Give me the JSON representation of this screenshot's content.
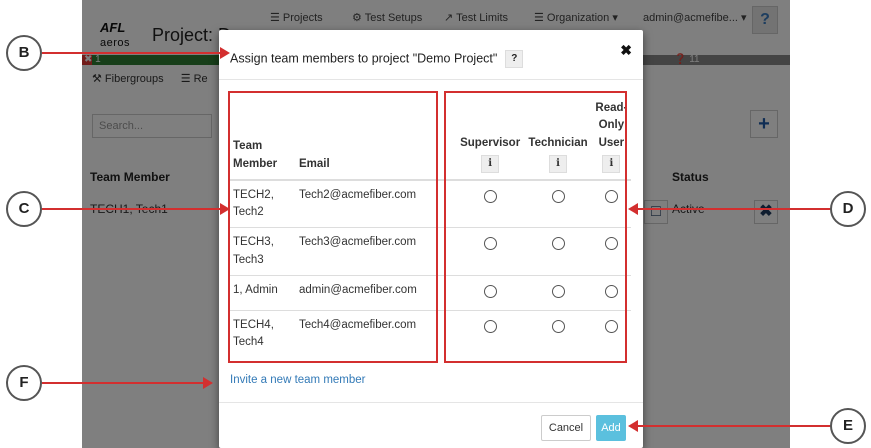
{
  "app": {
    "logo_top": "AFL",
    "logo_bottom": "aeros",
    "project_title": "Project: D",
    "nav": {
      "projects": "☰ Projects",
      "test_setups": "⚙ Test Setups",
      "test_limits": "↗ Test Limits",
      "organization": "☰ Organization ▾",
      "user": "admin@acmefibe... ▾",
      "help": "?"
    },
    "progress": {
      "left_count": "✖ 1",
      "right_count": "❓ 11"
    },
    "subnav": {
      "fibergroups": "⚒ Fibergroups",
      "reports": "☰ Re"
    },
    "search_placeholder": "Search...",
    "table_headers": {
      "team_member": "Team Member",
      "status": "Status"
    },
    "row": {
      "member": "TECH1, Tech1",
      "status": "Active"
    }
  },
  "modal": {
    "title": "Assign team members to project \"Demo Project\"",
    "help_label": "?",
    "close_label": "✖",
    "columns": {
      "team_member": [
        "Team",
        "Member"
      ],
      "email": "Email",
      "supervisor": "Supervisor",
      "technician": "Technician",
      "read_only": [
        "Read-",
        "Only",
        "User"
      ],
      "info": "i"
    },
    "members": [
      {
        "name": [
          "TECH2,",
          "Tech2"
        ],
        "email": "Tech2@acmefiber.com"
      },
      {
        "name": [
          "TECH3,",
          "Tech3"
        ],
        "email": "Tech3@acmefiber.com"
      },
      {
        "name": [
          "1, Admin"
        ],
        "email": "admin@acmefiber.com"
      },
      {
        "name": [
          "TECH4,",
          "Tech4"
        ],
        "email": "Tech4@acmefiber.com"
      }
    ],
    "invite_link": "Invite a new team member",
    "cancel_label": "Cancel",
    "add_label": "Add",
    "add_color": "#5bc0de"
  },
  "callouts": {
    "b": "B",
    "c": "C",
    "d": "D",
    "e": "E",
    "f": "F",
    "highlight_color": "#d32f2f"
  }
}
